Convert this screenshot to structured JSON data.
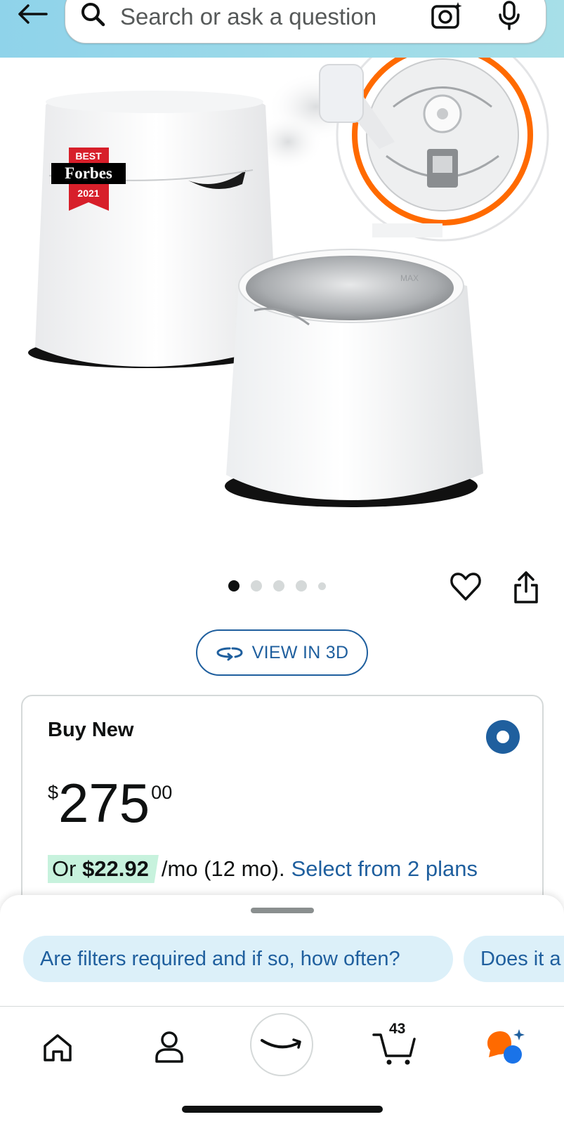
{
  "header": {
    "search_placeholder": "Search or ask a question",
    "icons": [
      "back-arrow-icon",
      "search-icon",
      "camera-icon",
      "microphone-icon"
    ],
    "background_color": "#a7dfe8"
  },
  "product": {
    "badge": {
      "line1": "BEST",
      "line2": "Forbes",
      "line3": "2021"
    },
    "carousel": {
      "total_images": 5,
      "active_index": 0
    },
    "view_3d_label": "VIEW IN 3D"
  },
  "buy_box": {
    "title": "Buy New",
    "selected": true,
    "price": {
      "symbol": "$",
      "whole": "275",
      "fraction": "00"
    },
    "monthly": {
      "prefix": "Or ",
      "amount": "$22.92",
      "terms": "/mo (12 mo).",
      "link": "Select from 2 plans"
    }
  },
  "suggestions": {
    "chips": [
      "Are filters required and if so, how often?",
      "Does it a"
    ]
  },
  "bottom_nav": {
    "items": [
      "home-icon",
      "account-icon",
      "amazon-smile-icon",
      "cart-icon",
      "rufus-ai-icon"
    ],
    "cart_count": "43"
  },
  "colors": {
    "link_blue": "#1f5f9e",
    "accent_orange": "#ff6a00",
    "monthly_highlight": "#c7f2dd",
    "chip_background": "#dcf0f9"
  }
}
